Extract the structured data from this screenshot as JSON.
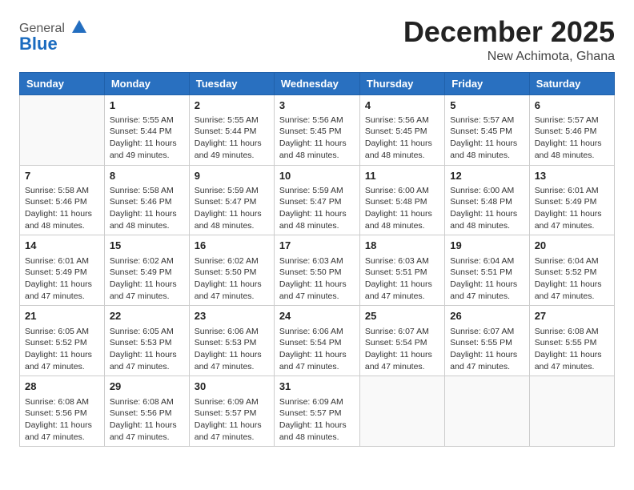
{
  "header": {
    "logo_general": "General",
    "logo_blue": "Blue",
    "main_title": "December 2025",
    "subtitle": "New Achimota, Ghana"
  },
  "days_of_week": [
    "Sunday",
    "Monday",
    "Tuesday",
    "Wednesday",
    "Thursday",
    "Friday",
    "Saturday"
  ],
  "weeks": [
    [
      {
        "day": "",
        "info": ""
      },
      {
        "day": "1",
        "info": "Sunrise: 5:55 AM\nSunset: 5:44 PM\nDaylight: 11 hours\nand 49 minutes."
      },
      {
        "day": "2",
        "info": "Sunrise: 5:55 AM\nSunset: 5:44 PM\nDaylight: 11 hours\nand 49 minutes."
      },
      {
        "day": "3",
        "info": "Sunrise: 5:56 AM\nSunset: 5:45 PM\nDaylight: 11 hours\nand 48 minutes."
      },
      {
        "day": "4",
        "info": "Sunrise: 5:56 AM\nSunset: 5:45 PM\nDaylight: 11 hours\nand 48 minutes."
      },
      {
        "day": "5",
        "info": "Sunrise: 5:57 AM\nSunset: 5:45 PM\nDaylight: 11 hours\nand 48 minutes."
      },
      {
        "day": "6",
        "info": "Sunrise: 5:57 AM\nSunset: 5:46 PM\nDaylight: 11 hours\nand 48 minutes."
      }
    ],
    [
      {
        "day": "7",
        "info": "Sunrise: 5:58 AM\nSunset: 5:46 PM\nDaylight: 11 hours\nand 48 minutes."
      },
      {
        "day": "8",
        "info": "Sunrise: 5:58 AM\nSunset: 5:46 PM\nDaylight: 11 hours\nand 48 minutes."
      },
      {
        "day": "9",
        "info": "Sunrise: 5:59 AM\nSunset: 5:47 PM\nDaylight: 11 hours\nand 48 minutes."
      },
      {
        "day": "10",
        "info": "Sunrise: 5:59 AM\nSunset: 5:47 PM\nDaylight: 11 hours\nand 48 minutes."
      },
      {
        "day": "11",
        "info": "Sunrise: 6:00 AM\nSunset: 5:48 PM\nDaylight: 11 hours\nand 48 minutes."
      },
      {
        "day": "12",
        "info": "Sunrise: 6:00 AM\nSunset: 5:48 PM\nDaylight: 11 hours\nand 48 minutes."
      },
      {
        "day": "13",
        "info": "Sunrise: 6:01 AM\nSunset: 5:49 PM\nDaylight: 11 hours\nand 47 minutes."
      }
    ],
    [
      {
        "day": "14",
        "info": "Sunrise: 6:01 AM\nSunset: 5:49 PM\nDaylight: 11 hours\nand 47 minutes."
      },
      {
        "day": "15",
        "info": "Sunrise: 6:02 AM\nSunset: 5:49 PM\nDaylight: 11 hours\nand 47 minutes."
      },
      {
        "day": "16",
        "info": "Sunrise: 6:02 AM\nSunset: 5:50 PM\nDaylight: 11 hours\nand 47 minutes."
      },
      {
        "day": "17",
        "info": "Sunrise: 6:03 AM\nSunset: 5:50 PM\nDaylight: 11 hours\nand 47 minutes."
      },
      {
        "day": "18",
        "info": "Sunrise: 6:03 AM\nSunset: 5:51 PM\nDaylight: 11 hours\nand 47 minutes."
      },
      {
        "day": "19",
        "info": "Sunrise: 6:04 AM\nSunset: 5:51 PM\nDaylight: 11 hours\nand 47 minutes."
      },
      {
        "day": "20",
        "info": "Sunrise: 6:04 AM\nSunset: 5:52 PM\nDaylight: 11 hours\nand 47 minutes."
      }
    ],
    [
      {
        "day": "21",
        "info": "Sunrise: 6:05 AM\nSunset: 5:52 PM\nDaylight: 11 hours\nand 47 minutes."
      },
      {
        "day": "22",
        "info": "Sunrise: 6:05 AM\nSunset: 5:53 PM\nDaylight: 11 hours\nand 47 minutes."
      },
      {
        "day": "23",
        "info": "Sunrise: 6:06 AM\nSunset: 5:53 PM\nDaylight: 11 hours\nand 47 minutes."
      },
      {
        "day": "24",
        "info": "Sunrise: 6:06 AM\nSunset: 5:54 PM\nDaylight: 11 hours\nand 47 minutes."
      },
      {
        "day": "25",
        "info": "Sunrise: 6:07 AM\nSunset: 5:54 PM\nDaylight: 11 hours\nand 47 minutes."
      },
      {
        "day": "26",
        "info": "Sunrise: 6:07 AM\nSunset: 5:55 PM\nDaylight: 11 hours\nand 47 minutes."
      },
      {
        "day": "27",
        "info": "Sunrise: 6:08 AM\nSunset: 5:55 PM\nDaylight: 11 hours\nand 47 minutes."
      }
    ],
    [
      {
        "day": "28",
        "info": "Sunrise: 6:08 AM\nSunset: 5:56 PM\nDaylight: 11 hours\nand 47 minutes."
      },
      {
        "day": "29",
        "info": "Sunrise: 6:08 AM\nSunset: 5:56 PM\nDaylight: 11 hours\nand 47 minutes."
      },
      {
        "day": "30",
        "info": "Sunrise: 6:09 AM\nSunset: 5:57 PM\nDaylight: 11 hours\nand 47 minutes."
      },
      {
        "day": "31",
        "info": "Sunrise: 6:09 AM\nSunset: 5:57 PM\nDaylight: 11 hours\nand 48 minutes."
      },
      {
        "day": "",
        "info": ""
      },
      {
        "day": "",
        "info": ""
      },
      {
        "day": "",
        "info": ""
      }
    ]
  ]
}
